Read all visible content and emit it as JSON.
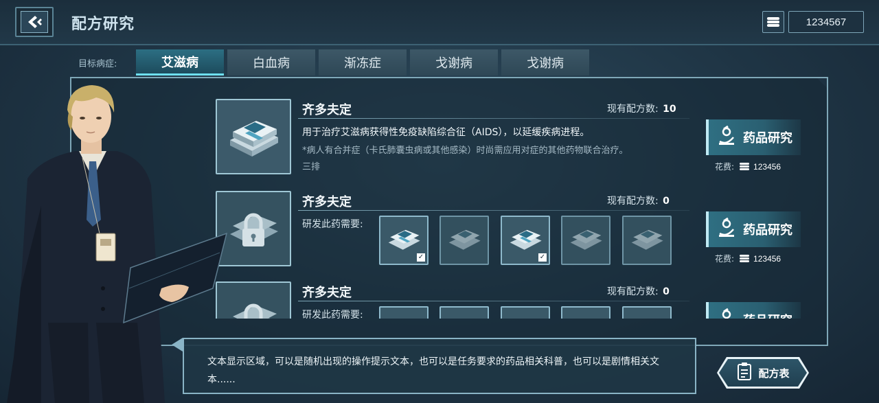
{
  "header": {
    "title": "配方研究",
    "currency_amount": "1234567"
  },
  "tabs": {
    "label": "目标病症:",
    "items": [
      {
        "label": "艾滋病",
        "active": true
      },
      {
        "label": "白血病",
        "active": false
      },
      {
        "label": "渐冻症",
        "active": false
      },
      {
        "label": "戈谢病",
        "active": false
      },
      {
        "label": "戈谢病",
        "active": false
      }
    ]
  },
  "recipes": [
    {
      "name": "齐多夫定",
      "count_label": "现有配方数:",
      "count": "10",
      "desc_line1": "用于治疗艾滋病获得性免疫缺陷综合征（AIDS），以延缓疾病进程。",
      "desc_line2": "*病人有合并症（卡氏肺囊虫病或其他感染）时尚需应用对症的其他药物联合治疗。",
      "desc_line3": "三排",
      "research_label": "药品研究",
      "cost_label": "花费:",
      "cost": "123456"
    },
    {
      "name": "齐多夫定",
      "count_label": "现有配方数:",
      "count": "0",
      "requires_label": "研发此药需要:",
      "ingredients": [
        {
          "checked": true
        },
        {
          "checked": false
        },
        {
          "checked": true
        },
        {
          "checked": false
        },
        {
          "checked": false
        }
      ],
      "research_label": "药品研究",
      "cost_label": "花费:",
      "cost": "123456"
    },
    {
      "name": "齐多夫定",
      "count_label": "现有配方数:",
      "count": "0",
      "requires_label": "研发此药需要:",
      "research_label": "药品研究"
    }
  ],
  "hint": {
    "text": "文本显示区域，可以是随机出现的操作提示文本，也可以是任务要求的药品相关科普，也可以是剧情相关文本......"
  },
  "formula_button": {
    "label": "配方表"
  },
  "colors": {
    "accent": "#6ee0f0",
    "border": "#7fa8b8",
    "background": "#1f3545"
  }
}
